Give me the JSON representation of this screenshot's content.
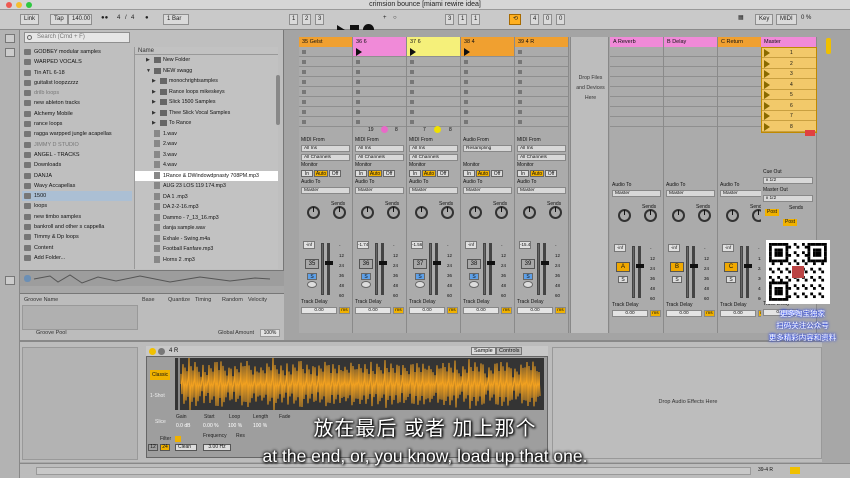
{
  "window": {
    "title": "crimsion bounce  [miami rewire idea]"
  },
  "transport": {
    "link": "Link",
    "tap": "Tap",
    "tempo": "140.00",
    "sig_num": "4",
    "sig_den": "4",
    "quant": "1 Bar",
    "pos_bar": "1",
    "pos_beat": "2",
    "pos_sub": "3",
    "loop_start": "3",
    "loop_mid": "1",
    "loop_end": "1",
    "key": "Key",
    "midi": "MIDI",
    "cpu": "0 %",
    "loop_len": "4",
    "loop_len2": "0",
    "loop_len3": "0"
  },
  "browser": {
    "search_placeholder": "Search (Cmd + F)",
    "col_name": "Name",
    "places": [
      "GODBEY modular samples",
      "WARPED VOCALS",
      "Tin ATL 6-18",
      "guitalist loopzzzzz",
      "drilb loops",
      "new ableton tracks",
      "Alchemy Mobile",
      "rance loops",
      "ragga warpped jungle acapellas",
      "JIMMY D STUDIO",
      "ANGEL - TRACKS",
      "Downloads",
      "DANJA",
      "Wavy Accapellas",
      "1500",
      "loops",
      "new timbo samples",
      "bankroll and other s cappella",
      "Timmy & Dp loops",
      "Content",
      "Add Folder..."
    ],
    "files": [
      "New Folder",
      "NEW swagg",
      "monochrightsamples",
      "Rance loops mikeskeys",
      "Slick 1500 Samples",
      "Thee Slick Vocal Samples",
      "To Rance",
      "1.wav",
      "2.wav",
      "3.wav",
      "4.wav",
      "1Rance & DWindowdpnasty 708PM.mp3",
      "AUG 23 LOS 119 174.mp3",
      "DA 1 .mp3",
      "DA 2-2-16.mp3",
      "Dammo - 7_13_16.mp3",
      "danja sample.wav",
      "Exhale - Swing.m4a",
      "Football Fanfare.mp3",
      "Horns 2 .mp3"
    ]
  },
  "groove": {
    "col_name": "Groove Name",
    "col_base": "Base",
    "col_quant": "Quantize",
    "col_timing": "Timing",
    "col_random": "Random",
    "col_velocity": "Velocity",
    "pool": "Groove Pool",
    "global_label": "Global Amount",
    "global_value": "100%"
  },
  "tracks": [
    {
      "name": "35 Gelst",
      "color": "#f0a030",
      "number": "35",
      "vol": "-inf",
      "io_from": "MIDI From",
      "from_val": "All Ins",
      "ch": "All Channels",
      "audio_to": "Audio To",
      "to_val": "Master",
      "delay_val": "0.00"
    },
    {
      "name": "36 6",
      "color": "#f08ad8",
      "number": "36",
      "vol": "-1.74",
      "io_from": "MIDI From",
      "from_val": "All Ins",
      "ch": "All Channels",
      "audio_to": "Audio To",
      "to_val": "Master",
      "delay_val": "0.00"
    },
    {
      "name": "37 6",
      "color": "#f5f07a",
      "number": "37",
      "vol": "-1.56",
      "io_from": "MIDI From",
      "from_val": "All Ins",
      "ch": "All Channels",
      "audio_to": "Audio To",
      "to_val": "Master",
      "delay_val": "0.00"
    },
    {
      "name": "38 4",
      "color": "#f0a030",
      "number": "38",
      "vol": "-inf",
      "io_from": "Audio From",
      "from_val": "Resampling",
      "ch": "",
      "audio_to": "Audio To",
      "to_val": "Master",
      "delay_val": "0.00"
    },
    {
      "name": "39 4 R",
      "color": "#f0a030",
      "number": "39",
      "vol": "-15.4",
      "io_from": "MIDI From",
      "from_val": "All Ins",
      "ch": "All Channels",
      "audio_to": "Audio To",
      "to_val": "Master",
      "delay_val": "0.00"
    }
  ],
  "returns": [
    {
      "name": "A Reverb",
      "color": "#f08ad8",
      "letter": "A",
      "vol": "-inf",
      "to_val": "Master",
      "delay_val": "0.00"
    },
    {
      "name": "B Delay",
      "color": "#f08ad8",
      "letter": "B",
      "vol": "-inf",
      "to_val": "Master",
      "delay_val": "0.00"
    },
    {
      "name": "C Return",
      "color": "#f0a030",
      "letter": "C",
      "vol": "-inf",
      "to_val": "Master",
      "delay_val": "0.00"
    }
  ],
  "master": {
    "name": "Master",
    "color": "#f08ad8",
    "scenes": [
      "1",
      "2",
      "3",
      "4",
      "5",
      "6",
      "7",
      "8"
    ],
    "cue_out": "Cue Out",
    "cue_val": "ii 1/2",
    "master_out": "Master Out",
    "master_val": "ii 1/2",
    "sends_label": "Sends",
    "post": "Post",
    "delay_val": "0.00"
  },
  "labels": {
    "sends": "Sends",
    "monitor": "Monitor",
    "in": "In",
    "auto": "Auto",
    "off": "Off",
    "track_delay": "Track Delay",
    "ms": "ms",
    "s": "S",
    "drop_files": [
      "Drop Files",
      "and Devices",
      "Here"
    ],
    "drop_fx": "Drop Audio Effects Here",
    "audio_to": "Audio To",
    "clip_37": "7",
    "clip_36": "19",
    "clip_36b": "8",
    "clip_37b": "8"
  },
  "mixer_scale": [
    "-",
    "12",
    "24",
    "36",
    "48",
    "60"
  ],
  "simpler": {
    "title": "4 R",
    "tab_sample": "Sample",
    "tab_controls": "Controls",
    "mode": "Classic",
    "one_shot": "1-Shot",
    "slice": "Slice",
    "gain_l": "Gain",
    "gain_v": "0.0 dB",
    "start_l": "Start",
    "start_v": "0.00 %",
    "loop_l": "Loop",
    "loop_v": "100 %",
    "length_l": "Length",
    "length_v": "100 %",
    "fade_l": "Fade",
    "filter_l": "Filter",
    "freq_l": "Frequency",
    "res_l": "Res",
    "freq_v": "3.00 Hz",
    "filter_type": "Clean",
    "num1": "12",
    "num2": "24"
  },
  "status": {
    "track": "39-4 R"
  },
  "overlay": {
    "subtitle_zh": "放在最后 或者 加上那个",
    "subtitle_en": "at the end, or, you know, load up that one.",
    "wm_lines": [
      "更多淘宝独家",
      "扫码关注公众号",
      "更多精彩内容和资料"
    ]
  }
}
